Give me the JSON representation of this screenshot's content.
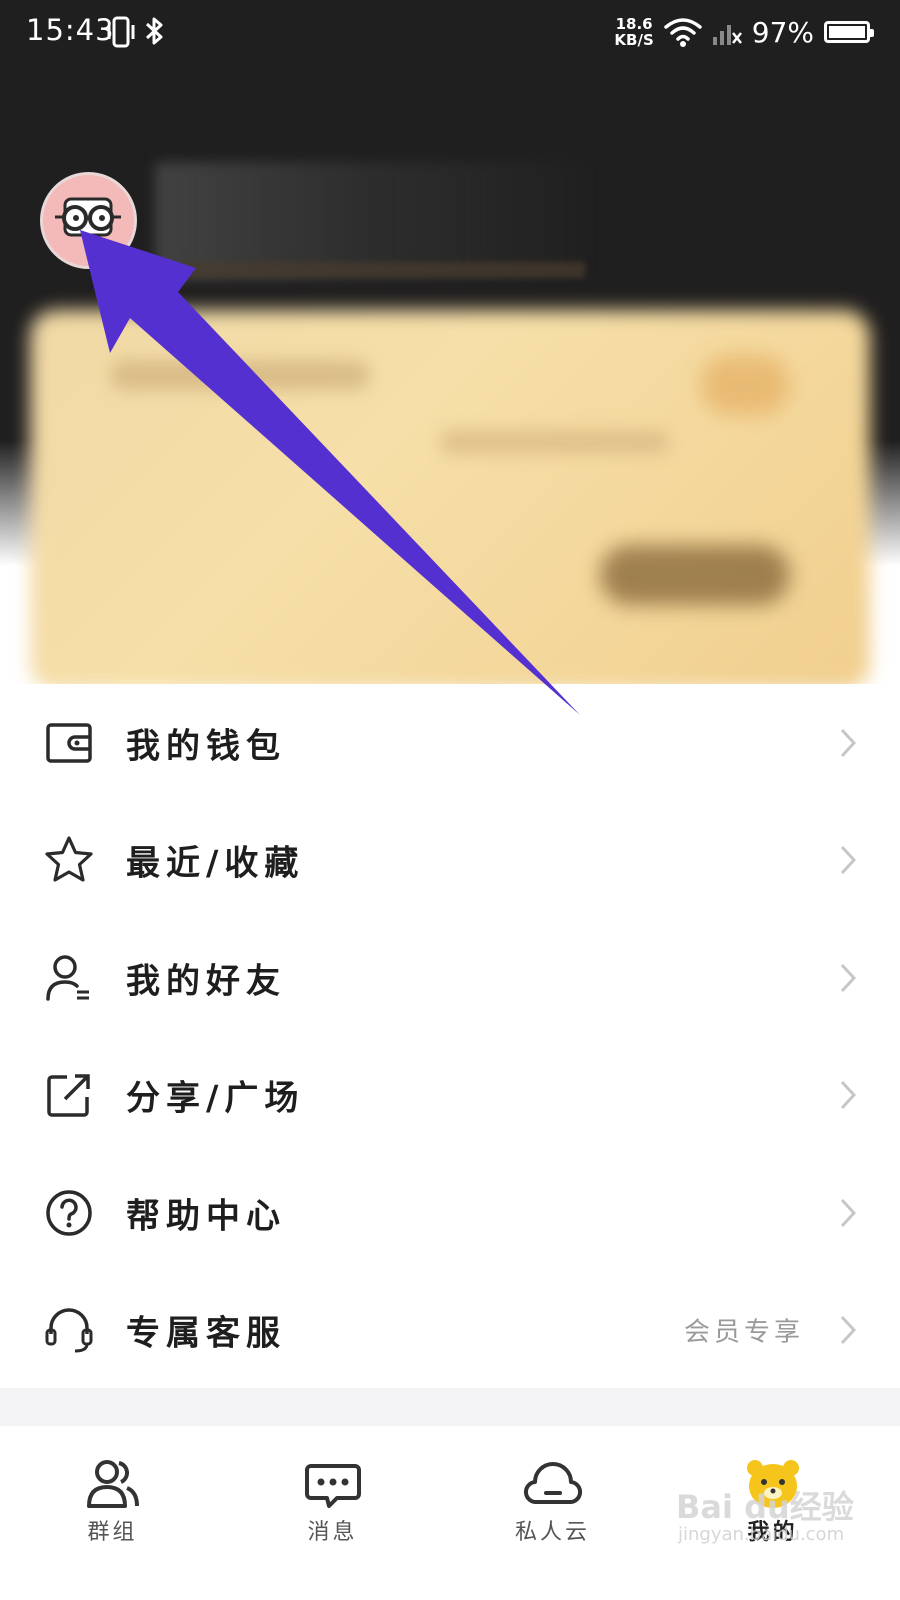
{
  "status_bar": {
    "time": "15:43",
    "net_speed_value": "18.6",
    "net_speed_unit": "KB/S",
    "battery": "97%"
  },
  "profile": {
    "avatar_icon": "cartoon-glasses-avatar"
  },
  "menu": [
    {
      "label": "我的钱包",
      "icon": "wallet-icon",
      "extra": ""
    },
    {
      "label": "最近/收藏",
      "icon": "star-icon",
      "extra": ""
    },
    {
      "label": "我的好友",
      "icon": "friend-icon",
      "extra": ""
    },
    {
      "label": "分享/广场",
      "icon": "share-icon",
      "extra": ""
    },
    {
      "label": "帮助中心",
      "icon": "help-icon",
      "extra": ""
    },
    {
      "label": "专属客服",
      "icon": "headset-icon",
      "extra": "会员专享"
    }
  ],
  "tabs": [
    {
      "label": "群组",
      "icon": "group-icon"
    },
    {
      "label": "消息",
      "icon": "message-icon"
    },
    {
      "label": "私人云",
      "icon": "cloud-icon"
    },
    {
      "label": "我的",
      "icon": "bear-icon",
      "active": true
    }
  ],
  "watermark": {
    "text": "Bai du经验",
    "sub": "jingyan.baidu.com"
  },
  "colors": {
    "header_bg": "#201f1f",
    "vip_card": "#f3d9a4",
    "arrow": "#5530d1",
    "avatar_bg": "#f2b6b6"
  }
}
